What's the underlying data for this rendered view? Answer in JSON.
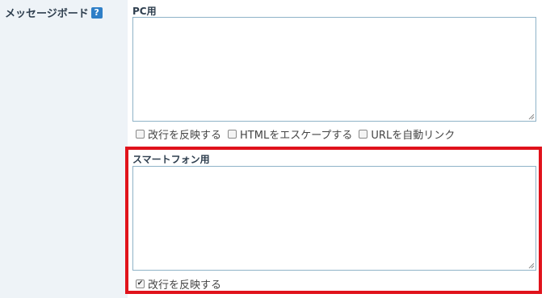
{
  "field": {
    "label": "メッセージボード",
    "help_icon": "?"
  },
  "pc": {
    "section_label": "PC用",
    "textarea_value": "",
    "options": [
      {
        "label": "改行を反映する",
        "checked": false
      },
      {
        "label": "HTMLをエスケープする",
        "checked": false
      },
      {
        "label": "URLを自動リンク",
        "checked": false
      }
    ]
  },
  "smartphone": {
    "section_label": "スマートフォン用",
    "textarea_value": "",
    "options": [
      {
        "label": "改行を反映する",
        "checked": true
      }
    ]
  },
  "highlight": {
    "color": "#e0121b"
  },
  "icons": {
    "help": "help-icon",
    "checkmark": "checkmark-icon"
  }
}
